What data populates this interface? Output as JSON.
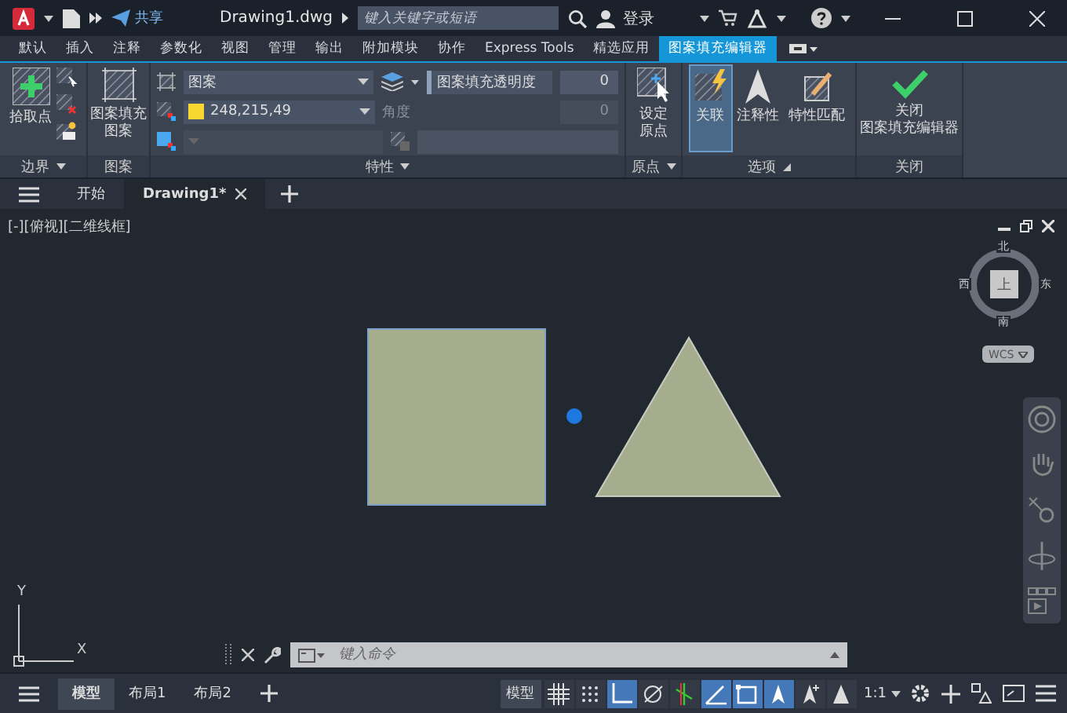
{
  "title_bar": {
    "share": "共享",
    "file_name": "Drawing1.dwg",
    "search": {
      "placeholder": "键入关键字或短语"
    },
    "sign_in": "登录"
  },
  "ribbon_tabs": [
    {
      "label": "默认",
      "selected": false
    },
    {
      "label": "插入",
      "selected": false
    },
    {
      "label": "注释",
      "selected": false
    },
    {
      "label": "参数化",
      "selected": false
    },
    {
      "label": "视图",
      "selected": false
    },
    {
      "label": "管理",
      "selected": false
    },
    {
      "label": "输出",
      "selected": false
    },
    {
      "label": "附加模块",
      "selected": false
    },
    {
      "label": "协作",
      "selected": false
    },
    {
      "label": "Express Tools",
      "selected": false
    },
    {
      "label": "精选应用",
      "selected": false
    },
    {
      "label": "图案填充编辑器",
      "selected": true
    }
  ],
  "ribbon": {
    "boundary": {
      "pick_points": "拾取点",
      "panel_title": "边界"
    },
    "pattern": {
      "button": "图案填充图案",
      "panel_title": "图案"
    },
    "properties": {
      "pattern_type": "图案",
      "transparency_label": "图案填充透明度",
      "transparency": "0",
      "hatch_color": "248,215,49",
      "angle_label": "角度",
      "angle": "0",
      "panel_title": "特性"
    },
    "origin": {
      "button": "设定原点",
      "panel_title": "原点"
    },
    "options": {
      "buttons": [
        {
          "label": "关联",
          "kind": "associative",
          "selected": true
        },
        {
          "label": "注释性",
          "kind": "annotative",
          "selected": false
        },
        {
          "label": "特性匹配",
          "kind": "match",
          "selected": false
        }
      ],
      "panel_title": "选项"
    },
    "close": {
      "button_lines": [
        "关闭",
        "图案填充编辑器"
      ],
      "panel_title": "关闭"
    }
  },
  "file_tabs": [
    {
      "label": "开始",
      "selected": false
    },
    {
      "label": "Drawing1*",
      "selected": true
    }
  ],
  "viewport": {
    "label": "[-][俯视][二维线框]",
    "viewcube": {
      "north": "北",
      "south": "南",
      "east": "东",
      "west": "西",
      "face": "上",
      "ucs": "WCS"
    },
    "axis_x": "X",
    "axis_y": "Y"
  },
  "command_line": {
    "placeholder": "键入命令"
  },
  "status_bar": {
    "layout_tabs": [
      {
        "label": "模型",
        "selected": true
      },
      {
        "label": "布局1",
        "selected": false
      },
      {
        "label": "布局2",
        "selected": false
      }
    ],
    "model_button": "模型",
    "toggles": [
      {
        "kind": "grid",
        "on": false
      },
      {
        "kind": "snap",
        "on": false
      },
      {
        "kind": "ortho",
        "on": true
      },
      {
        "kind": "polar",
        "on": false
      },
      {
        "kind": "track",
        "on": false
      },
      {
        "kind": "angle",
        "on": true
      },
      {
        "kind": "select",
        "on": true
      },
      {
        "kind": "annotate",
        "on": true
      },
      {
        "kind": "autoscale",
        "on": false
      },
      {
        "kind": "visibility",
        "on": false
      }
    ],
    "scale": "1:1"
  }
}
